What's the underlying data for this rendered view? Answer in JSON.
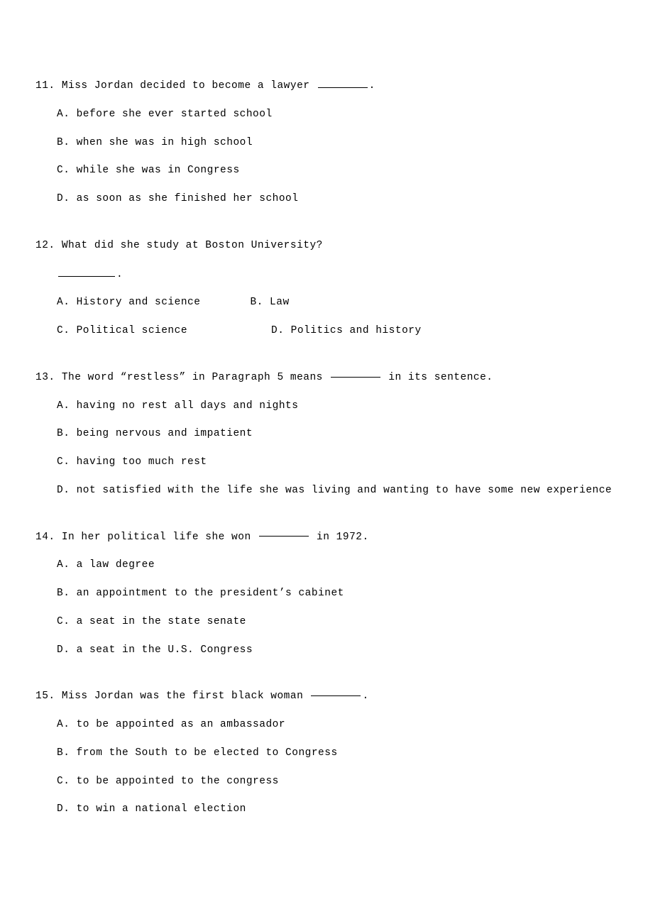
{
  "questions": [
    {
      "number": "11.",
      "text_pre": "Miss Jordan decided to become a lawyer ",
      "text_post": ".",
      "layout": "vertical",
      "options": [
        {
          "letter": "A.",
          "text": "before she ever started school"
        },
        {
          "letter": "B.",
          "text": "when she was in high school"
        },
        {
          "letter": "C.",
          "text": "while she was in Congress"
        },
        {
          "letter": "D.",
          "text": "as soon as she finished her school"
        }
      ]
    },
    {
      "number": "12.",
      "text_pre": "What did she study at Boston University?",
      "text_post": "",
      "layout": "two-col",
      "has_standalone_blank": true,
      "options": [
        {
          "letter": "A.",
          "text": "History and science"
        },
        {
          "letter": "B.",
          "text": "Law"
        },
        {
          "letter": "C.",
          "text": "Political science"
        },
        {
          "letter": "D.",
          "text": "Politics and history"
        }
      ]
    },
    {
      "number": "13.",
      "text_pre": "The word “restless” in Paragraph 5 means ",
      "text_post": " in its sentence.",
      "layout": "vertical",
      "blank_style": "thick",
      "options": [
        {
          "letter": "A.",
          "text": "having no rest all days and nights"
        },
        {
          "letter": "B.",
          "text": "being nervous and impatient"
        },
        {
          "letter": "C.",
          "text": "having too much rest"
        },
        {
          "letter": "D.",
          "text": "not satisfied with the life she was living and wanting to have some new experience"
        }
      ]
    },
    {
      "number": "14.",
      "text_pre": " In her political life she won ",
      "text_post": " in 1972.",
      "layout": "vertical",
      "blank_style": "thick",
      "options": [
        {
          "letter": "A.",
          "text": "a law degree"
        },
        {
          "letter": "B.",
          "text": "an appointment to the president’s cabinet"
        },
        {
          "letter": "C.",
          "text": "a seat in the state senate"
        },
        {
          "letter": "D.",
          "text": "a seat in the U.S. Congress"
        }
      ]
    },
    {
      "number": "15.",
      "text_pre": "Miss Jordan was the first black woman ",
      "text_post": ".",
      "layout": "vertical",
      "blank_style": "thick",
      "options": [
        {
          "letter": "A.",
          "text": " to be appointed as an ambassador"
        },
        {
          "letter": "B.",
          "text": " from the South to be elected to Congress"
        },
        {
          "letter": "C.",
          "text": " to be appointed to the congress"
        },
        {
          "letter": "D.",
          "text": " to win a national election"
        }
      ]
    }
  ],
  "col_gaps": {
    "q12_row1_gap": "70px",
    "q12_row2_gap": "118px"
  }
}
